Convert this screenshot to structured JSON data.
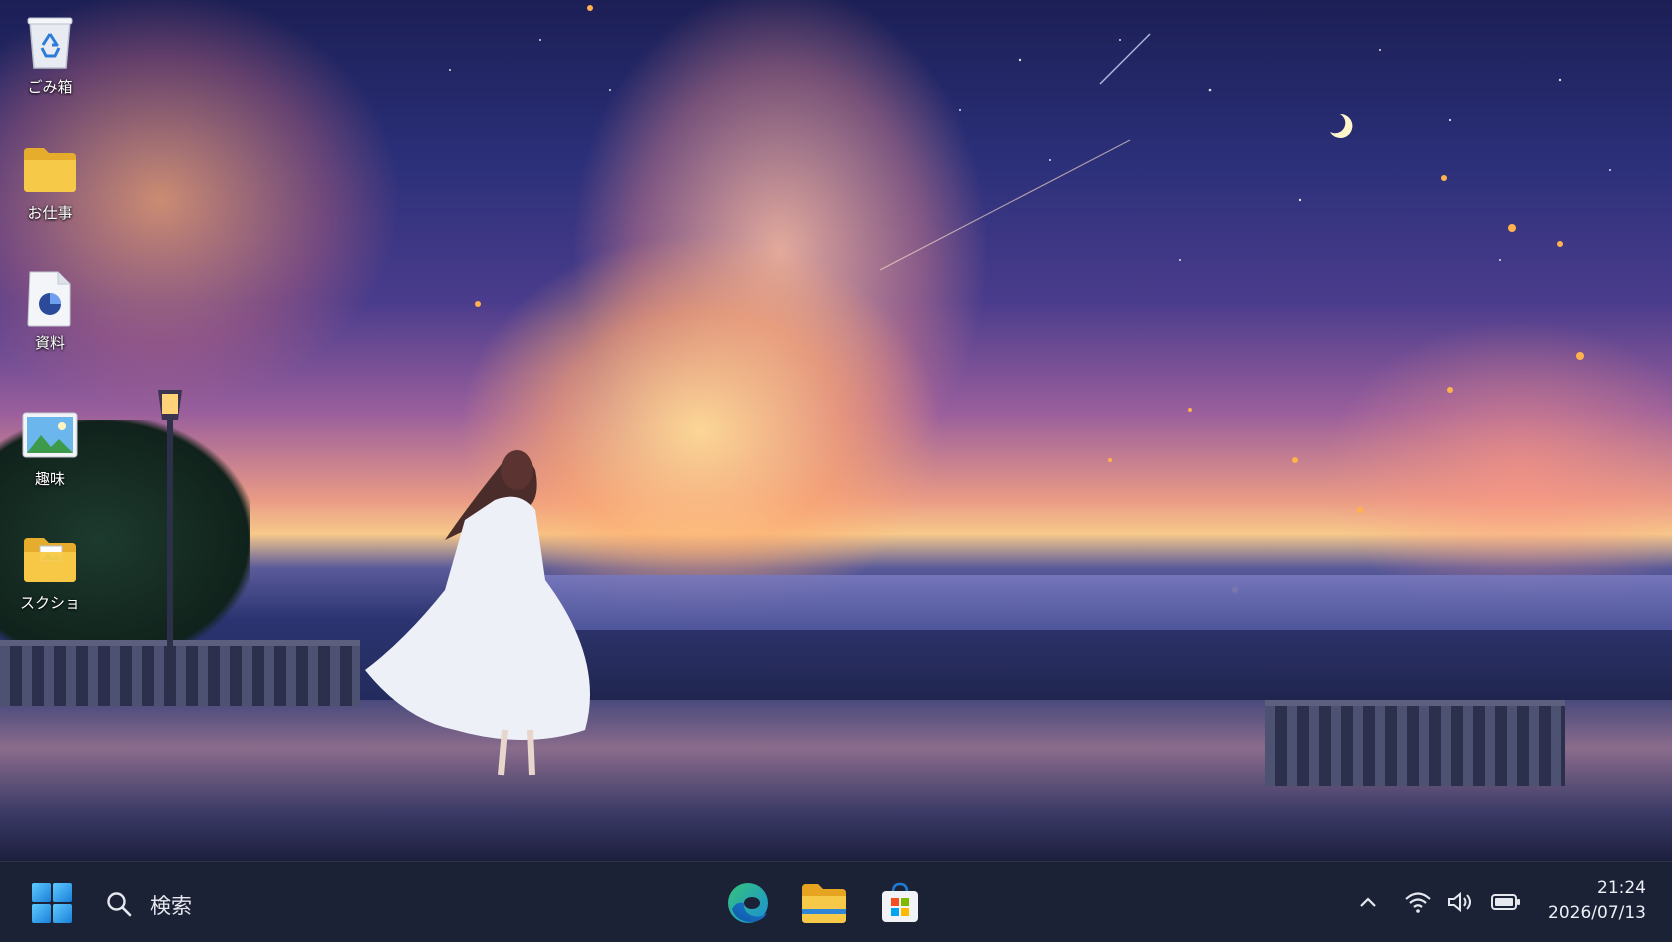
{
  "desktop": {
    "icons": [
      {
        "label": "ごみ箱",
        "icon": "recycle-bin-icon"
      },
      {
        "label": "お仕事",
        "icon": "folder-icon"
      },
      {
        "label": "資料",
        "icon": "chart-document-icon"
      },
      {
        "label": "趣味",
        "icon": "image-file-icon"
      },
      {
        "label": "スクショ",
        "icon": "image-folder-icon"
      }
    ]
  },
  "taskbar": {
    "start_icon": "windows-start-icon",
    "search_icon": "search-icon",
    "search_text": "検索",
    "pinned": [
      {
        "icon": "edge-browser-icon"
      },
      {
        "icon": "file-explorer-icon"
      },
      {
        "icon": "microsoft-store-icon"
      }
    ],
    "tray": {
      "icons": [
        "chevron-up-icon",
        "wifi-icon",
        "speaker-icon",
        "battery-icon"
      ]
    },
    "clock": {
      "time": "21:24",
      "date": "2026/07/13"
    }
  },
  "colors": {
    "taskbar_bg": "#1c2235",
    "folder_yellow": "#f7c948",
    "edge_blue": "#1f7ad6",
    "edge_green": "#2fbf71"
  }
}
